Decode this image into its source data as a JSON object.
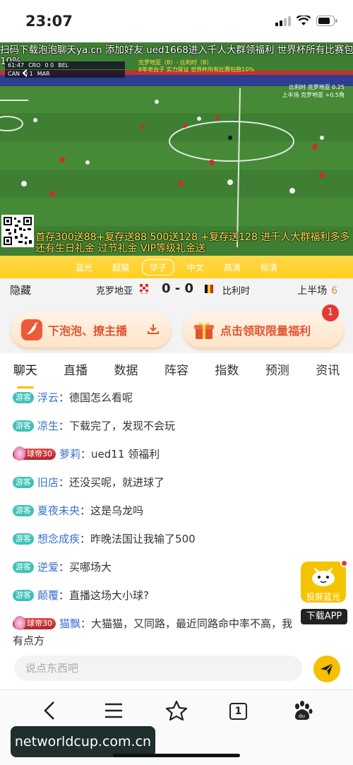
{
  "status_bar": {
    "time": "23:07"
  },
  "video": {
    "marquee_line1": "扫码下载泡泡聊天ya.cn 添加好友 ued1668进入千人大群领福利 世界杯所有比赛包赔",
    "marquee_line2": "10%",
    "score_overlay": {
      "row1_time": "61:47",
      "row1_team_a": "CRO",
      "row1_score": "0  0",
      "row1_team_b": "BEL",
      "row2_team_a": "CAN",
      "row2_score": "0  1",
      "row2_team_b": "MAR"
    },
    "top_promo_line1": "克罗地亚（B）- 比利时（B）",
    "top_promo_line2": "8年老台子 实力保证  世界杯所有比赛包赔10%",
    "right_promo_line1": "比利时  克罗地亚 0.25",
    "right_promo_line2": "上半场  克罗地亚 +0.5角",
    "bottom_promo": "首存300送88+复存送88 500送128 +复存送128 进千人大群福利多多 还有生日礼金 过节礼金 VIP等级礼金送"
  },
  "quality_options": [
    "蓝光",
    "超猫",
    "华子",
    "中文",
    "高清",
    "标清"
  ],
  "quality_selected": "华子",
  "match": {
    "hide_label": "隐藏",
    "team_a": "克罗地亚",
    "score": "0 - 0",
    "team_b": "比利时",
    "half_label": "上半场",
    "minute": "6"
  },
  "promos": {
    "left_label": "下泡泡、撩主播",
    "right_label": "点击领取限量福利",
    "badge_count": "1"
  },
  "tabs": [
    "聊天",
    "直播",
    "数据",
    "阵容",
    "指数",
    "预测",
    "资讯"
  ],
  "active_tab": "聊天",
  "chat": [
    {
      "badge": "游客",
      "badge_type": "guest",
      "user": "浮云",
      "text": "德国怎么看呢"
    },
    {
      "badge": "游客",
      "badge_type": "guest",
      "user": "凉生",
      "text": "下载完了，发现不会玩"
    },
    {
      "badge": "球帝30",
      "badge_type": "vip",
      "user": "萝莉",
      "text": "ued11 领福利"
    },
    {
      "badge": "游客",
      "badge_type": "guest",
      "user": "旧店",
      "text": "还没买呢，就进球了"
    },
    {
      "badge": "游客",
      "badge_type": "guest",
      "user": "夏夜未央",
      "text": "这是乌龙吗"
    },
    {
      "badge": "游客",
      "badge_type": "guest",
      "user": "想念成疾",
      "text": "昨晚法国让我输了500"
    },
    {
      "badge": "游客",
      "badge_type": "guest",
      "user": "逆爱",
      "text": "买哪场大"
    },
    {
      "badge": "游客",
      "badge_type": "guest",
      "user": "颠覆",
      "text": "直播这场大小球?"
    },
    {
      "badge": "球帝30",
      "badge_type": "vip",
      "user": "猫飘",
      "text": "大猫猫，又同路，最近同路命中率不高，我有点方"
    }
  ],
  "cast": {
    "label": "投屏蓝光",
    "download_label": "下载APP"
  },
  "input": {
    "placeholder": "说点东西吧"
  },
  "browser_nav": {
    "tab_count": "1"
  },
  "watermark": "networldcup.com.cn",
  "colors": {
    "accent_yellow": "#f5c000",
    "promo_red": "#e2532f",
    "username_blue": "#3a6fcf",
    "guest_badge": "#3ec1b8",
    "vip_badge": "#c9333a"
  }
}
